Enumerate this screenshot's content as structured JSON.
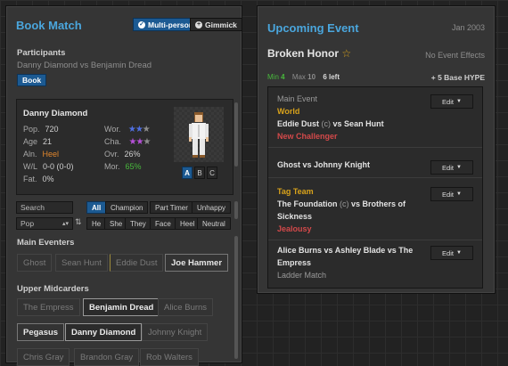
{
  "left": {
    "title": "Book Match",
    "toggles": [
      {
        "label": "Multi-person",
        "icon": "check",
        "active": true
      },
      {
        "label": "Gimmick",
        "icon": "plus",
        "active": false
      }
    ],
    "participants_label": "Participants",
    "participants_text": "Danny Diamond vs Benjamin Dread",
    "book_button": "Book",
    "card": {
      "name": "Danny Diamond",
      "stats_left": [
        {
          "k": "Pop.",
          "v": "720"
        },
        {
          "k": "Age",
          "v": "21"
        },
        {
          "k": "Aln.",
          "v": "Heel"
        },
        {
          "k": "W/L",
          "v": "0-0 (0-0)"
        },
        {
          "k": "Fat.",
          "v": "0%"
        }
      ],
      "stats_right": [
        {
          "k": "Wor.",
          "v": "★★★"
        },
        {
          "k": "Cha.",
          "v": "★★★"
        },
        {
          "k": "Ovr.",
          "v": "26%"
        },
        {
          "k": "Mor.",
          "v": "65%"
        }
      ],
      "wor_stars": 2,
      "cha_stars": 2,
      "abc": [
        "A",
        "B",
        "C"
      ],
      "colors": {
        "heel": "#e0862c",
        "mor": "#48b83c",
        "star_blue": "#4f6fe0",
        "star_purple": "#b650d8",
        "star_grey": "#8c8c8c"
      }
    },
    "search_placeholder": "Search",
    "filter_tabs": [
      "All",
      "Champion",
      "Part Timer",
      "Unhappy"
    ],
    "sort_value": "Pop",
    "gender_filters": [
      "He",
      "She",
      "They",
      "Face",
      "Heel",
      "Neutral"
    ],
    "sections": [
      {
        "name": "Main Eventers",
        "items": [
          "Ghost",
          "Sean Hunt",
          "Eddie Dust",
          "Joe Hammer"
        ]
      },
      {
        "name": "Upper Midcarders",
        "items": [
          "The Empress",
          "Benjamin Dread",
          "Alice Burns",
          "Pegasus",
          "Danny Diamond",
          "Johnny Knight",
          "Chris Gray",
          "Brandon Gray",
          "Rob Walters"
        ]
      }
    ]
  },
  "right": {
    "title": "Upcoming Event",
    "date": "Jan 2003",
    "event_name": "Broken Honor",
    "effects": "No Event Effects",
    "min_label": "Min",
    "min_value": "4",
    "max_label": "Max",
    "max_value": "10",
    "left_label": "6 left",
    "hype": "+ 5 Base HYPE",
    "edit_label": "Edit",
    "matches": [
      {
        "header": "Main Event",
        "title": "World",
        "line1": "Eddie Dust",
        "champ_tag": "(c)",
        "line1b": "vs Sean Hunt",
        "extra": "New Challenger"
      },
      {
        "line": "Ghost vs Johnny Knight"
      },
      {
        "title": "Tag Team",
        "line1": "The Foundation",
        "champ_tag": "(c)",
        "line1b": "vs Brothers of",
        "line2": "Sickness",
        "extra": "Jealousy"
      },
      {
        "line1": "Alice Burns vs Ashley Blade vs The",
        "line2": "Empress",
        "sub": "Ladder Match"
      }
    ],
    "colors": {
      "accent": "#4aa6dd",
      "gold": "#d8a21b",
      "red": "#d3494a",
      "green": "#48b83c"
    }
  }
}
